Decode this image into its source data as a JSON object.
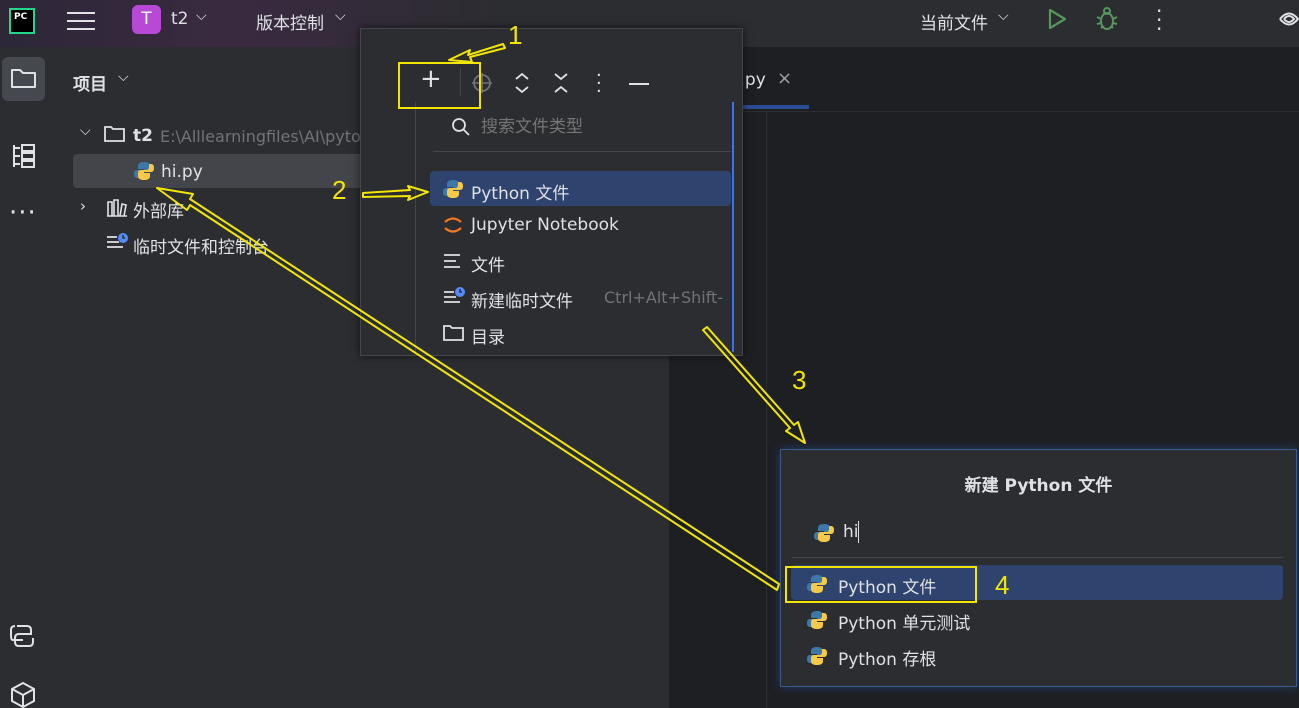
{
  "titlebar": {
    "logo_text": "PC",
    "project_initial": "T",
    "project_name": "t2",
    "vcs_menu": "版本控制",
    "run_config": "当前文件"
  },
  "project_panel": {
    "title": "项目",
    "tree": {
      "root_name": "t2",
      "root_path": "E:\\Alllearningfiles\\AI\\pytorch\\",
      "file_hi": "hi.py",
      "external_libs": "外部库",
      "scratches": "临时文件和控制台"
    }
  },
  "editor": {
    "tab_label": "hi.py"
  },
  "new_popup": {
    "search_placeholder": "搜索文件类型",
    "items": [
      {
        "label": "Python 文件",
        "icon": "python-icon"
      },
      {
        "label": "Jupyter Notebook",
        "icon": "jupyter-icon"
      },
      {
        "label": "文件",
        "icon": "text-file-icon"
      },
      {
        "label": "新建临时文件",
        "shortcut": "Ctrl+Alt+Shift-",
        "icon": "scratch-icon"
      },
      {
        "label": "目录",
        "icon": "folder-icon"
      }
    ]
  },
  "new_python_dialog": {
    "title": "新建 Python 文件",
    "input_value": "hi",
    "options": [
      {
        "label": "Python 文件"
      },
      {
        "label": "Python 单元测试"
      },
      {
        "label": "Python 存根"
      }
    ]
  },
  "annotations": {
    "n1": "1",
    "n2": "2",
    "n3": "3",
    "n4": "4",
    "color": "#f2e600"
  },
  "colors": {
    "accent": "#3574f0",
    "selection": "#2e436e",
    "panel": "#2b2d30",
    "editor": "#1e1f22"
  }
}
